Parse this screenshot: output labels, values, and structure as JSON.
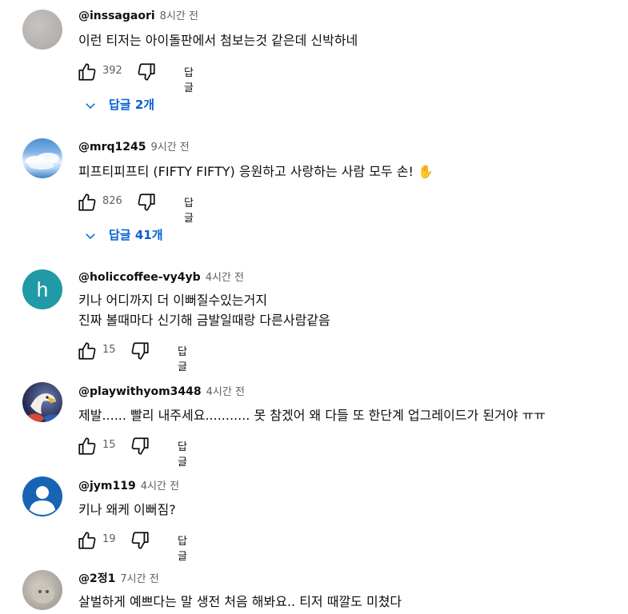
{
  "comments": [
    {
      "author": "@inssagaori",
      "time": "8시간 전",
      "lines": [
        "이런 티저는  아이돌판에서 첨보는것 같은데 신박하네"
      ],
      "likes": "392",
      "reply_label": "답글",
      "replies_label": "답글 2개",
      "avatar": "gray-avatar"
    },
    {
      "author": "@mrq1245",
      "time": "9시간 전",
      "lines": [
        "피프티피프티 (FIFTY FIFTY) 응원하고 사랑하는 사람 모두 손! ✋"
      ],
      "likes": "826",
      "reply_label": "답글",
      "replies_label": "답글 41개",
      "avatar": "sky-avatar"
    },
    {
      "author": "@holiccoffee-vy4yb",
      "time": "4시간 전",
      "lines": [
        "키나 어디까지 더 이뻐질수있는거지",
        "진짜 볼때마다 신기해 금발일때랑 다른사람같음"
      ],
      "likes": "15",
      "reply_label": "답글",
      "avatar": "letter-avatar",
      "avatar_letter": "h"
    },
    {
      "author": "@playwithyom3448",
      "time": "4시간 전",
      "lines": [
        "제발...... 빨리 내주세요........... 못 참겠어 왜 다들 또 한단계 업그레이드가 된거야 ㅠㅠ"
      ],
      "likes": "15",
      "reply_label": "답글",
      "avatar": "eagle-avatar"
    },
    {
      "author": "@jym119",
      "time": "4시간 전",
      "lines": [
        "키나 왜케 이뻐짐?"
      ],
      "likes": "19",
      "reply_label": "답글",
      "avatar": "default-person-avatar"
    },
    {
      "author": "@2정1",
      "time": "7시간 전",
      "lines": [
        "살벌하게 예쁘다는 말 생전 처음 해봐요.. 티저 때깔도 미쳤다"
      ],
      "avatar": "photo-avatar"
    }
  ],
  "colors": {
    "link_blue": "#065fd4",
    "meta_gray": "#606060",
    "letter_avatar_bg": "#1f9aa6",
    "person_avatar_bg": "#1864b4"
  }
}
